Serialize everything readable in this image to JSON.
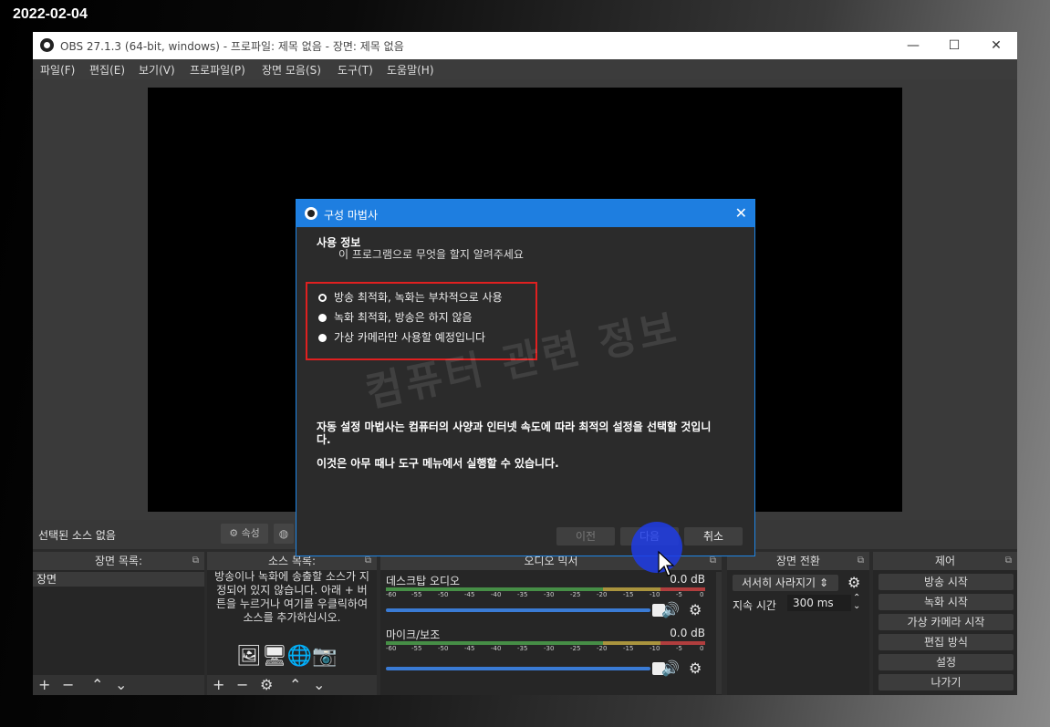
{
  "overlay_date": "2022-02-04",
  "window": {
    "title": "OBS 27.1.3 (64-bit, windows) - 프로파일: 제목 없음 - 장면: 제목 없음",
    "controls": [
      "—",
      "☐",
      "✕"
    ]
  },
  "menu": [
    "파일(F)",
    "편집(E)",
    "보기(V)",
    "프로파일(P)",
    "장면 모음(S)",
    "도구(T)",
    "도움말(H)"
  ],
  "watermark": "컴퓨터 관련 정보",
  "source_toolbar": {
    "no_source": "선택된 소스 없음",
    "properties": "속성"
  },
  "docks": {
    "scenes": {
      "title": "장면 목록",
      "items": [
        "장면"
      ]
    },
    "sources": {
      "title": "소스 목록",
      "empty_text": "방송이나 녹화에 송출할 소스가 지정되어 있지 않습니다. 아래 + 버튼을 누르거나 여기를 우클릭하여 소스를 추가하십시오."
    },
    "mixer": {
      "title": "오디오 믹서",
      "ticks": [
        "-60",
        "-55",
        "-50",
        "-45",
        "-40",
        "-35",
        "-30",
        "-25",
        "-20",
        "-15",
        "-10",
        "-5",
        "0"
      ],
      "channels": [
        {
          "name": "데스크탑 오디오",
          "level": "0.0 dB"
        },
        {
          "name": "마이크/보조",
          "level": "0.0 dB"
        }
      ]
    },
    "transitions": {
      "title": "장면 전환",
      "selected": "서서히 사라지기",
      "duration_label": "지속 시간",
      "duration_value": "300 ms"
    },
    "controls": {
      "title": "제어",
      "buttons": [
        "방송 시작",
        "녹화 시작",
        "가상 카메라 시작",
        "편집 방식",
        "설정",
        "나가기"
      ]
    }
  },
  "dialog": {
    "title": "구성 마법사",
    "heading": "사용 정보",
    "subheading": "이 프로그램으로 무엇을 할지 알려주세요",
    "options": [
      {
        "label": "방송 최적화, 녹화는 부차적으로 사용",
        "selected": true
      },
      {
        "label": "녹화 최적화, 방송은 하지 않음",
        "selected": false
      },
      {
        "label": "가상 카메라만 사용할 예정입니다",
        "selected": false
      }
    ],
    "info1": "자동 설정 마법사는 컴퓨터의 사양과 인터넷 속도에 따라 최적의 설정을 선택할 것입니다.",
    "info2": "이것은 아무 때나 도구 메뉴에서 실행할 수 있습니다.",
    "buttons": {
      "prev": "이전",
      "next": "다음",
      "cancel": "취소"
    }
  }
}
